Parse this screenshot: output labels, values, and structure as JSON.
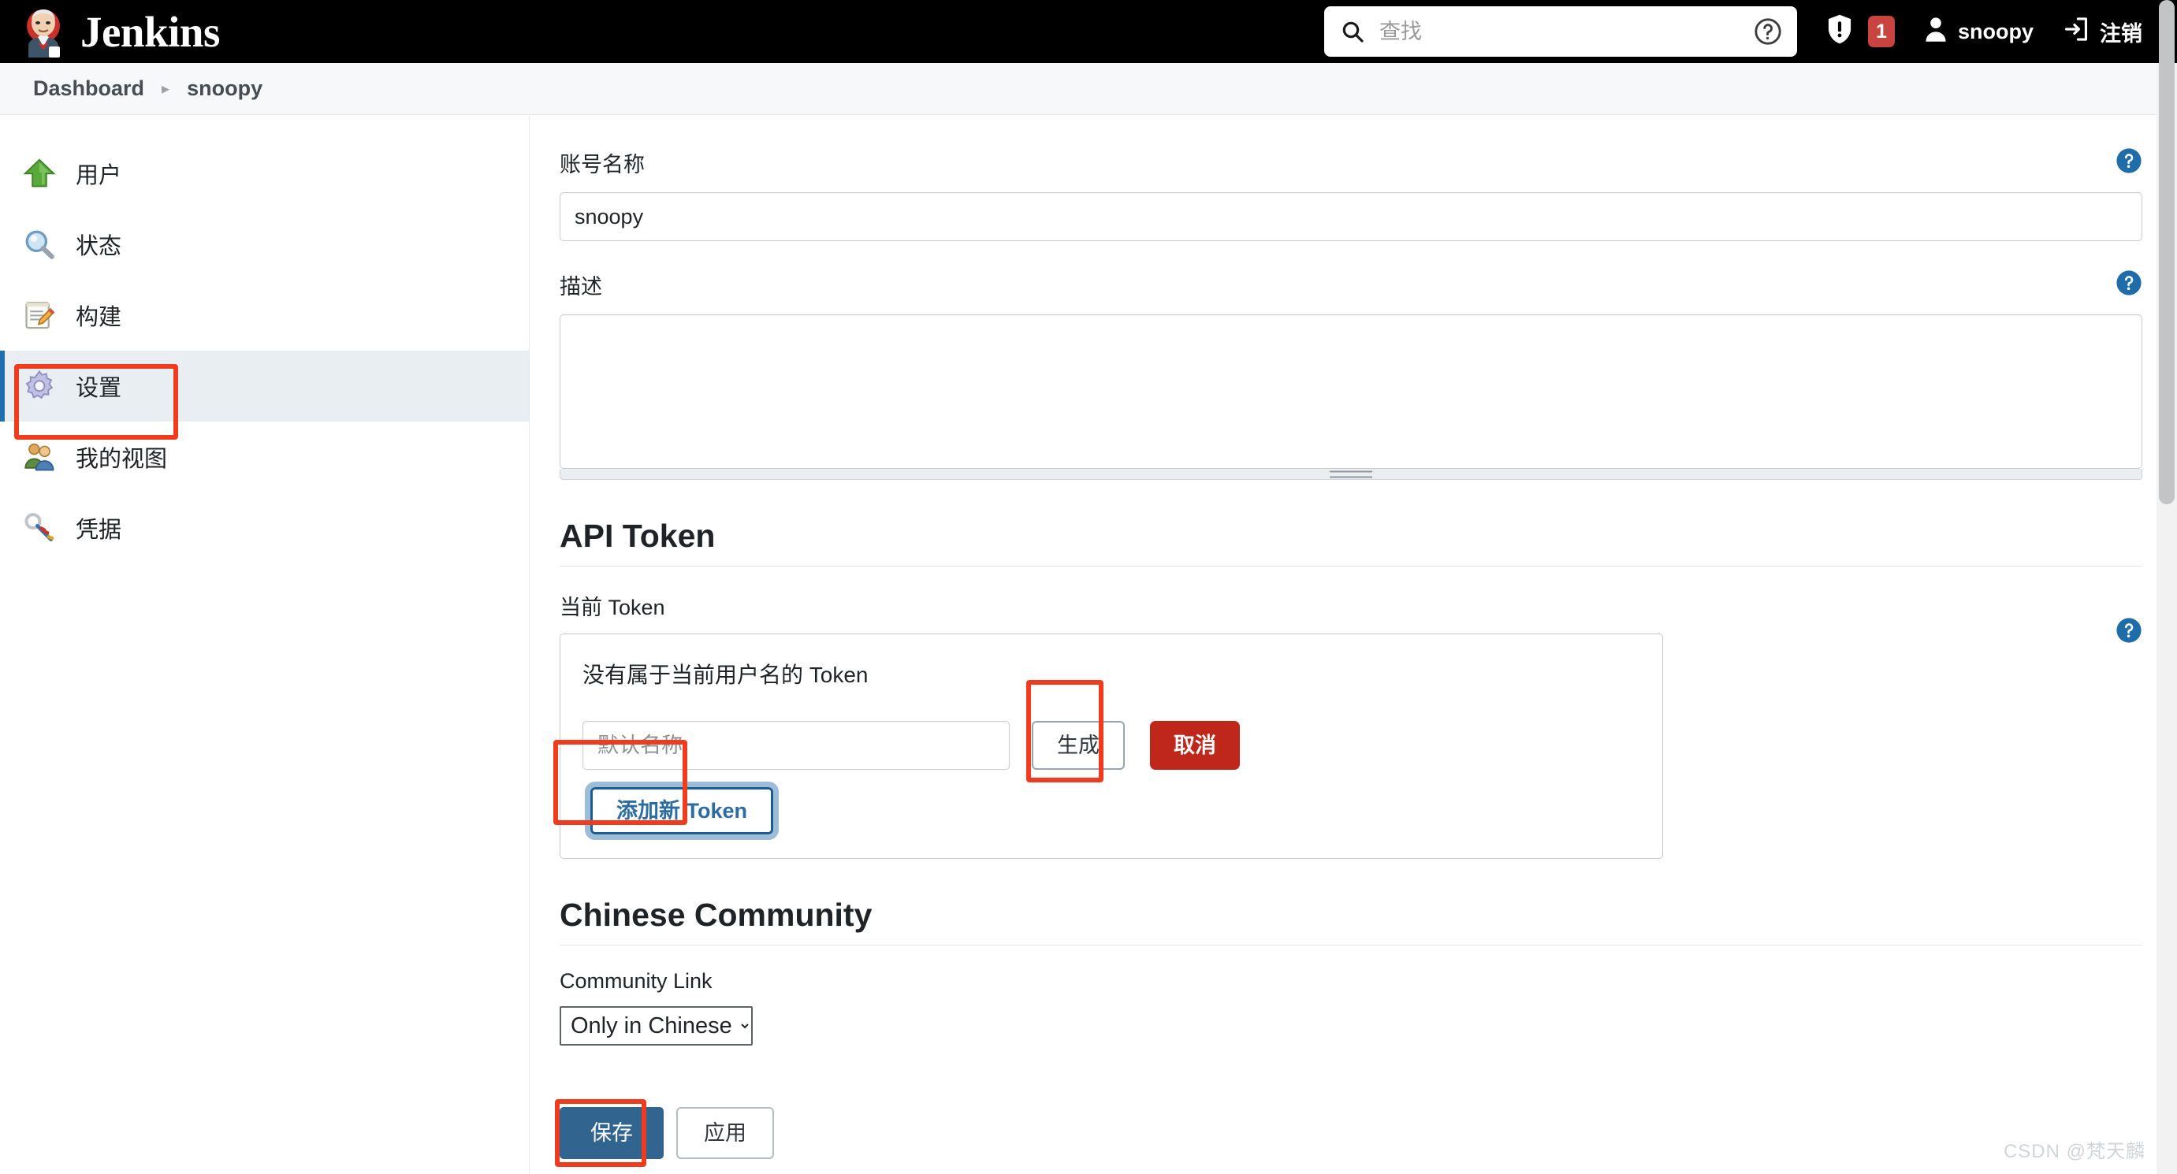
{
  "header": {
    "brand_text": "Jenkins",
    "brand_icon": "jenkins-butler-logo",
    "search": {
      "placeholder": "查找",
      "value": "",
      "icon": "search-icon",
      "help_icon": "question-circle-icon"
    },
    "security_icon": "shield-exclamation-icon",
    "security_badge": "1",
    "user_icon": "person-icon",
    "user_name": "snoopy",
    "logout_icon": "logout-arrow-icon",
    "logout_label": "注销"
  },
  "breadcrumb": {
    "items": [
      "Dashboard",
      "snoopy"
    ],
    "separator": "▸"
  },
  "sidebar": {
    "items": [
      {
        "label": "用户",
        "icon": "green-up-arrow-icon",
        "active": false
      },
      {
        "label": "状态",
        "icon": "magnifier-icon",
        "active": false
      },
      {
        "label": "构建",
        "icon": "notepad-pencil-icon",
        "active": false
      },
      {
        "label": "设置",
        "icon": "gear-icon",
        "active": true
      },
      {
        "label": "我的视图",
        "icon": "people-icon",
        "active": false
      },
      {
        "label": "凭据",
        "icon": "keys-icon",
        "active": false
      }
    ]
  },
  "form": {
    "account_name": {
      "label": "账号名称",
      "value": "snoopy",
      "help_icon": "help-icon"
    },
    "description": {
      "label": "描述",
      "value": "",
      "help_icon": "help-icon"
    }
  },
  "api_token": {
    "section_title": "API Token",
    "current_token_label": "当前 Token",
    "help_icon": "help-icon",
    "empty_message": "没有属于当前用户名的 Token",
    "name_input_placeholder": "默认名称",
    "name_input_value": "",
    "generate_label": "生成",
    "cancel_label": "取消",
    "add_token_label": "添加新 Token"
  },
  "chinese_community": {
    "section_title": "Chinese Community",
    "community_link_label": "Community Link",
    "select_value": "Only in Chinese",
    "select_options": [
      "Only in Chinese"
    ],
    "chevron_icon": "chevron-down-icon"
  },
  "footer": {
    "save_label": "保存",
    "apply_label": "应用"
  },
  "watermark": "CSDN @梵天麟",
  "colors": {
    "header_bg": "#000000",
    "primary_blue": "#31648F",
    "danger_red": "#C0271B",
    "badge_red": "#C9443F",
    "highlight_red": "#F03C1E",
    "active_sidebar_bg": "#E9EEF3",
    "active_sidebar_bar": "#1F6FB2"
  }
}
